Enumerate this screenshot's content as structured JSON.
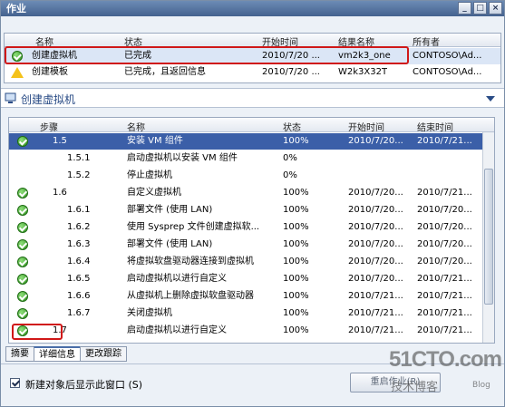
{
  "window": {
    "title": "作业"
  },
  "jobs": {
    "columns": [
      "名称",
      "状态",
      "开始时间",
      "结果名称",
      "所有者"
    ],
    "rows": [
      {
        "name": "创建虚拟机",
        "status": "已完成",
        "start": "2010/7/20 ...",
        "result": "vm2k3_one",
        "owner": "CONTOSO\\Ad...",
        "icon": "ok-icon"
      },
      {
        "name": "创建模板",
        "status": "已完成，且返回信息",
        "start": "2010/7/20 ...",
        "result": "W2k3X32T",
        "owner": "CONTOSO\\Ad...",
        "icon": "warn-icon"
      }
    ]
  },
  "section": {
    "title": "创建虚拟机"
  },
  "steps": {
    "columns": [
      "步骤",
      "名称",
      "状态",
      "开始时间",
      "结束时间"
    ],
    "rows": [
      {
        "step": "1.5",
        "name": "安装 VM 组件",
        "status": "100%",
        "start": "2010/7/20...",
        "end": "2010/7/21...",
        "ok": true,
        "indent": 1
      },
      {
        "step": "1.5.1",
        "name": "启动虚拟机以安装 VM 组件",
        "status": "0%",
        "start": "",
        "end": "",
        "ok": false,
        "indent": 2
      },
      {
        "step": "1.5.2",
        "name": "停止虚拟机",
        "status": "0%",
        "start": "",
        "end": "",
        "ok": false,
        "indent": 2
      },
      {
        "step": "1.6",
        "name": "自定义虚拟机",
        "status": "100%",
        "start": "2010/7/20...",
        "end": "2010/7/21...",
        "ok": true,
        "indent": 1
      },
      {
        "step": "1.6.1",
        "name": "部署文件 (使用 LAN)",
        "status": "100%",
        "start": "2010/7/20...",
        "end": "2010/7/20...",
        "ok": true,
        "indent": 2
      },
      {
        "step": "1.6.2",
        "name": "使用 Sysprep 文件创建虚拟软...",
        "status": "100%",
        "start": "2010/7/20...",
        "end": "2010/7/20...",
        "ok": true,
        "indent": 2
      },
      {
        "step": "1.6.3",
        "name": "部署文件 (使用 LAN)",
        "status": "100%",
        "start": "2010/7/20...",
        "end": "2010/7/20...",
        "ok": true,
        "indent": 2
      },
      {
        "step": "1.6.4",
        "name": "将虚拟软盘驱动器连接到虚拟机",
        "status": "100%",
        "start": "2010/7/20...",
        "end": "2010/7/20...",
        "ok": true,
        "indent": 2
      },
      {
        "step": "1.6.5",
        "name": "启动虚拟机以进行自定义",
        "status": "100%",
        "start": "2010/7/20...",
        "end": "2010/7/21...",
        "ok": true,
        "indent": 2
      },
      {
        "step": "1.6.6",
        "name": "从虚拟机上删除虚拟软盘驱动器",
        "status": "100%",
        "start": "2010/7/21...",
        "end": "2010/7/21...",
        "ok": true,
        "indent": 2
      },
      {
        "step": "1.6.7",
        "name": "关闭虚拟机",
        "status": "100%",
        "start": "2010/7/21...",
        "end": "2010/7/21...",
        "ok": true,
        "indent": 2
      },
      {
        "step": "1.7",
        "name": "启动虚拟机以进行自定义",
        "status": "100%",
        "start": "2010/7/21...",
        "end": "2010/7/21...",
        "ok": true,
        "indent": 1
      }
    ]
  },
  "tabs": [
    "摘要",
    "详细信息",
    "更改跟踪"
  ],
  "bottom": {
    "checkbox_label": "新建对象后显示此窗口 (S)",
    "restart_label": "重启作业(R)"
  },
  "watermark": {
    "site": "51CTO.com",
    "sub": "技术博客",
    "blog": "Blog"
  }
}
